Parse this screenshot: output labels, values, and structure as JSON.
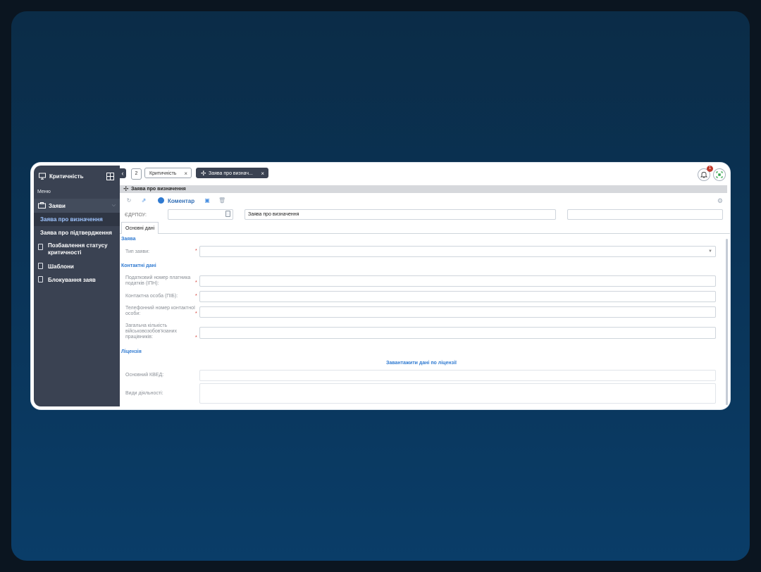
{
  "sidebar": {
    "title": "Критичність",
    "menu_label": "Меню",
    "group_label": "Заяви",
    "items": [
      {
        "label": "Заява про визначення"
      },
      {
        "label": "Заява про підтвердження"
      },
      {
        "label": "Позбавлення статусу критичності"
      },
      {
        "label": "Шаблони"
      },
      {
        "label": "Блокування заяв"
      }
    ]
  },
  "topbar": {
    "tab_count": "2",
    "tabs": [
      {
        "label": "Критичність"
      },
      {
        "label": "Заява про визнач..."
      }
    ],
    "notification_count": "1"
  },
  "window": {
    "title": "Заява про визначення"
  },
  "toolbar": {
    "comment_label": "Коментар"
  },
  "header_fields": {
    "edrpou_label": "ЄДРПОУ:",
    "edrpou_value": "",
    "request_type_value": "Заява про визначення",
    "extra_value": ""
  },
  "form": {
    "tab_label": "Основні дані",
    "sections": {
      "request": "Заява",
      "contacts": "Контактні дані",
      "license": "Ліцензія"
    },
    "fields": {
      "request_type": {
        "label": "Тип заяви:",
        "value": ""
      },
      "tax_number": {
        "label": "Податковий номер платника податків (ІПН):",
        "value": ""
      },
      "contact_person": {
        "label": "Контактна особа (ПІБ):",
        "value": ""
      },
      "contact_phone": {
        "label": "Телефонний номер контактної особи:",
        "value": ""
      },
      "conscripts_count": {
        "label": "Загальна кількість військовозобов'язаних працівників:",
        "value": ""
      },
      "main_kved": {
        "label": "Основний КВЕД:",
        "value": ""
      },
      "activities": {
        "label": "Види діяльності:",
        "value": ""
      }
    },
    "load_license_link": "Завантажити дані по ліцензії"
  }
}
